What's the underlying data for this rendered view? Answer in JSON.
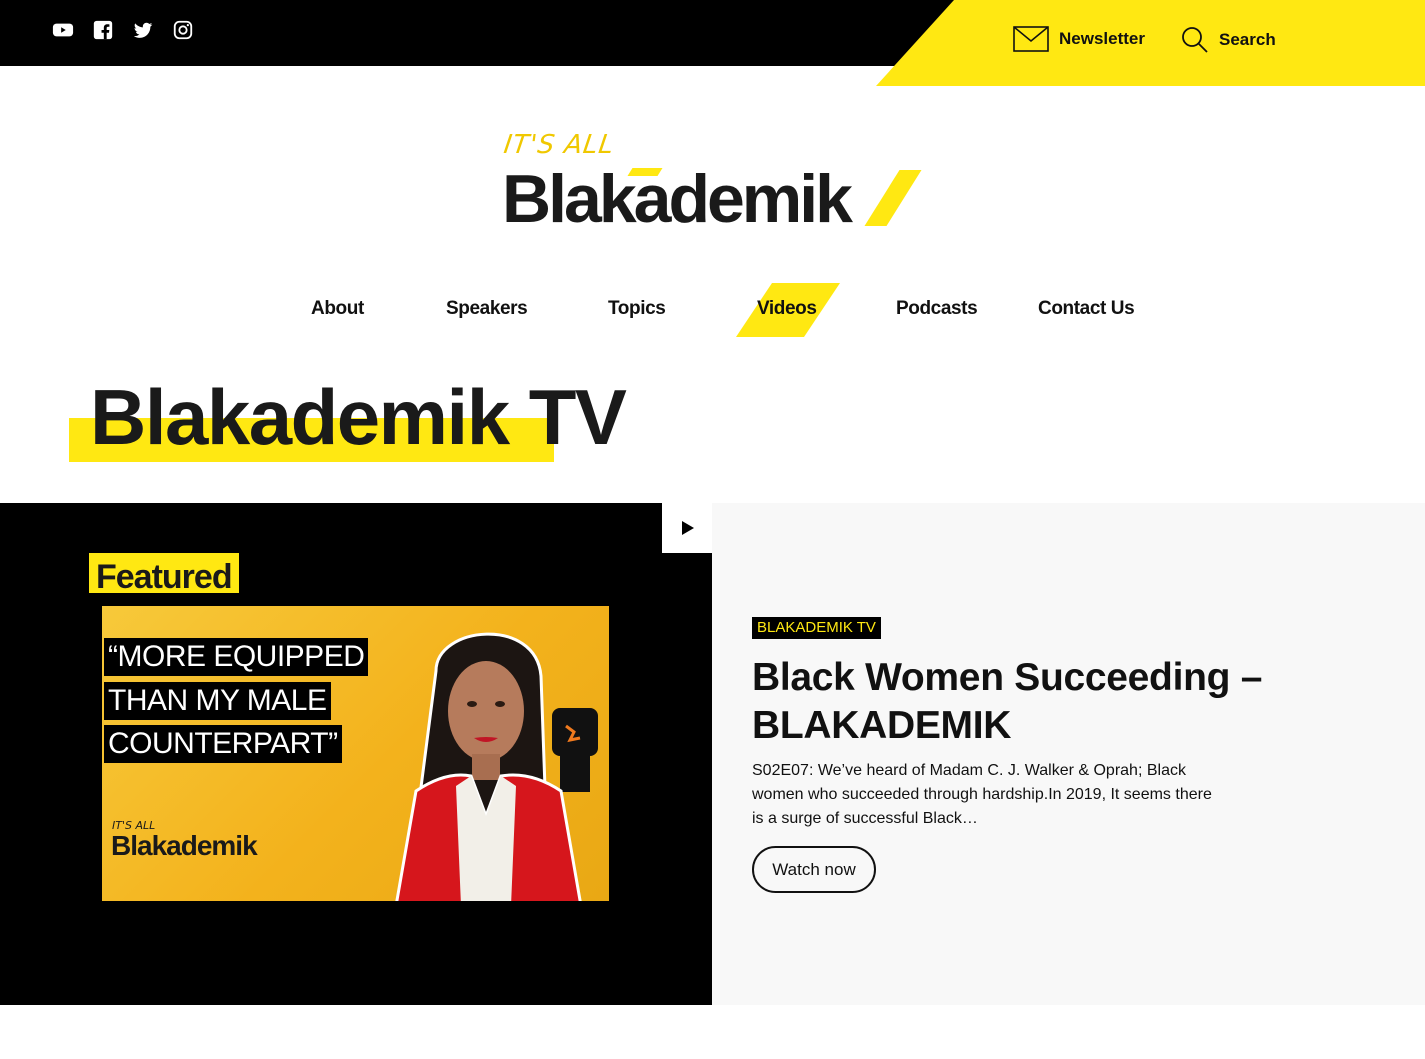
{
  "social": {
    "icons": [
      "youtube-icon",
      "facebook-icon",
      "twitter-icon",
      "instagram-icon"
    ]
  },
  "utility": {
    "newsletter_label": "Newsletter",
    "search_label": "Search"
  },
  "logo": {
    "small": "IT'S ALL",
    "main": "Blakademik"
  },
  "nav": {
    "items": [
      {
        "label": "About"
      },
      {
        "label": "Speakers"
      },
      {
        "label": "Topics"
      },
      {
        "label": "Videos",
        "active": true
      },
      {
        "label": "Podcasts"
      },
      {
        "label": "Contact Us"
      }
    ]
  },
  "page": {
    "title": "Blakademik TV"
  },
  "featured": {
    "label": "Featured",
    "thumbnail": {
      "quote_lines": [
        "“MORE EQUIPPED",
        "THAN MY MALE",
        "COUNTERPART”"
      ],
      "logo_small": "IT'S ALL",
      "logo_main": "Blakademik"
    },
    "category": "BLAKADEMIK TV",
    "headline": "Black Women Succeeding – BLAKADEMIK",
    "excerpt": "S02E07: We’ve heard of Madam C. J. Walker & Oprah; Black women who succeeded through hardship.In 2019, It seems there is a surge of successful Black…",
    "cta": "Watch now"
  },
  "colors": {
    "accent": "#ffe812",
    "dark": "#000000",
    "panel": "#f8f8f8"
  }
}
